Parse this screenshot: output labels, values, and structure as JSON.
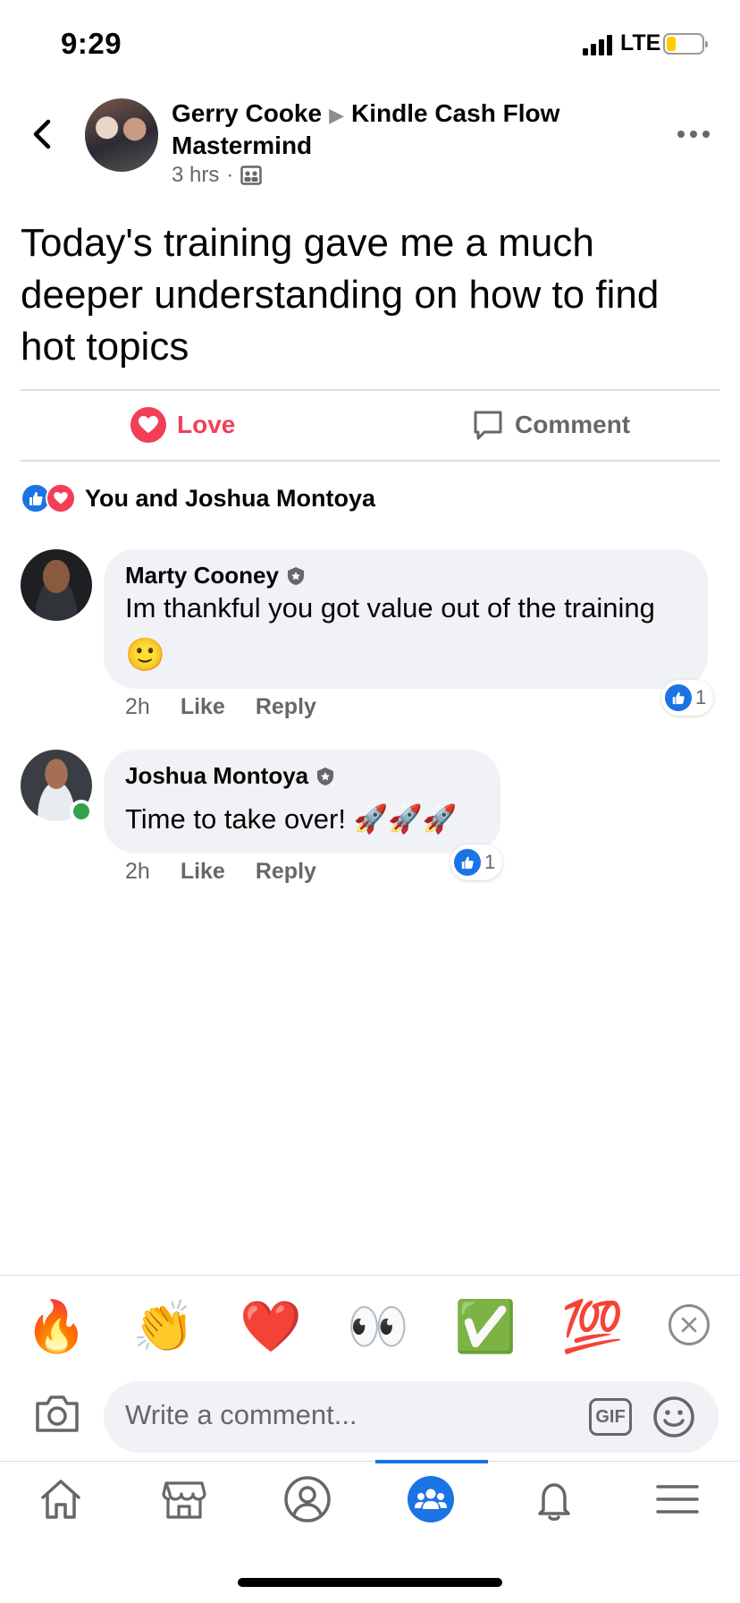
{
  "status_bar": {
    "time": "9:29",
    "network": "LTE"
  },
  "post": {
    "author": "Gerry Cooke",
    "group": "Kindle Cash Flow Mastermind",
    "time": "3 hrs",
    "dot": "·",
    "text": "Today's training  gave me a much deeper understanding on how to find hot topics"
  },
  "actions": {
    "love_label": "Love",
    "comment_label": "Comment"
  },
  "reactions": {
    "summary": "You and Joshua Montoya"
  },
  "comments": [
    {
      "name": "Marty Cooney",
      "text": "Im thankful you got value out of the training",
      "emoji": "🙂",
      "time": "2h",
      "like_label": "Like",
      "reply_label": "Reply",
      "like_count": "1"
    },
    {
      "name": "Joshua Montoya",
      "text": "Time to take over! 🚀🚀🚀",
      "time": "2h",
      "like_label": "Like",
      "reply_label": "Reply",
      "like_count": "1"
    }
  ],
  "emoji_bar": [
    "🔥",
    "👏",
    "❤️",
    "👀",
    "✅",
    "💯"
  ],
  "composer": {
    "placeholder": "Write a comment...",
    "gif_label": "GIF"
  },
  "tabs": [
    "home-icon",
    "marketplace-icon",
    "profile-icon",
    "groups-icon",
    "notifications-icon",
    "menu-icon"
  ],
  "colors": {
    "accent": "#1b74e4",
    "love": "#f33e58",
    "online": "#31a24c"
  }
}
